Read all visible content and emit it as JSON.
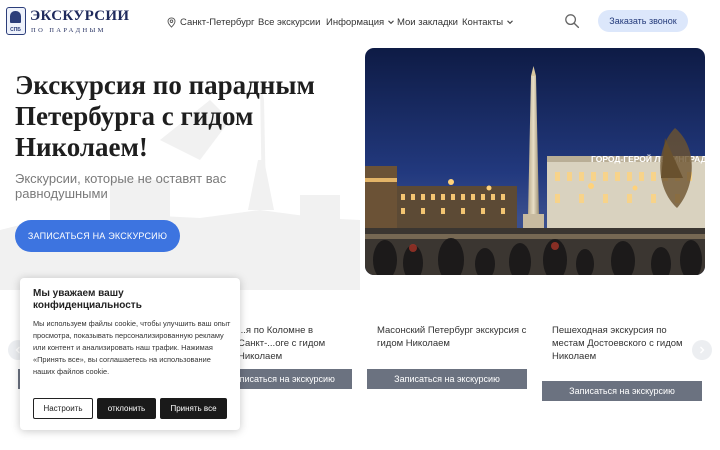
{
  "header": {
    "logo": {
      "title": "ЭКСКУРСИИ",
      "subtitle": "ПО ПАРАДНЫМ",
      "badge_text": "СПБ"
    },
    "nav": [
      {
        "label": "Санкт-Петербург",
        "icon": "map-pin-icon",
        "has_dropdown": false
      },
      {
        "label": "Все экскурсии",
        "has_dropdown": false
      },
      {
        "label": "Информация",
        "has_dropdown": true
      },
      {
        "label": "Мои закладки",
        "has_dropdown": false
      },
      {
        "label": "Контакты",
        "has_dropdown": true
      }
    ],
    "search_icon": "search-icon",
    "call_button": "Заказать звонок"
  },
  "hero": {
    "title": "Экскурсия по парадным Петербурга с гидом Николаем!",
    "subtitle": "Экскурсии, которые не оставят вас равнодушными",
    "button": "ЗАПИСАТЬСЯ НА ЭКСКУРСИЮ",
    "photo_caption": "ГОРОД-ГЕРОЙ ЛЕНИНГРАД"
  },
  "tours": {
    "cards": [
      {
        "title": "...я по Коломне в Санкт-...оге с гидом Николаем",
        "button": "Записаться на экскурсию"
      },
      {
        "title": "Масонский Петербург экскурсия с гидом Николаем",
        "button": "Записаться на экскурсию"
      },
      {
        "title": "Пешеходная экскурсия по местам Достоевского с гидом Николаем",
        "button": "Записаться на экскурсию"
      }
    ],
    "prev_icon": "chevron-left-icon",
    "next_icon": "chevron-right-icon"
  },
  "cookie": {
    "title": "Мы уважаем вашу конфиденциальность",
    "text": "Мы используем файлы cookie, чтобы улучшить ваш опыт просмотра, показывать персонализированную рекламу или контент и анализировать наш трафик. Нажимая «Принять все», вы соглашаетесь на использование наших файлов cookie.",
    "settings_button": "Настроить",
    "reject_button": "отклонить",
    "accept_button": "Принять все"
  },
  "colors": {
    "accent": "#3d74e0",
    "call_button_bg": "#dce7fb",
    "logo_navy": "#1f2a5c",
    "card_button": "#6b7280"
  }
}
